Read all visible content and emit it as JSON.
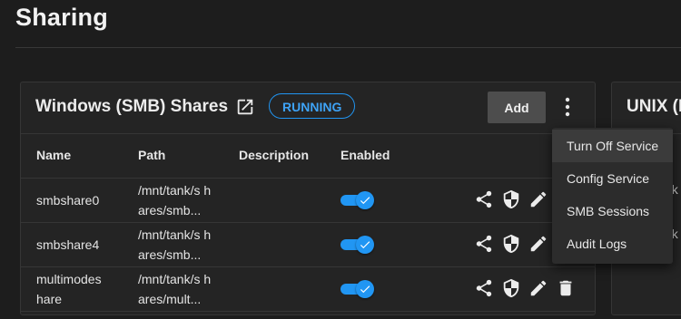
{
  "page": {
    "title": "Sharing"
  },
  "smb_card": {
    "title": "Windows (SMB) Shares",
    "status": "RUNNING",
    "add_label": "Add",
    "columns": [
      "Name",
      "Path",
      "Description",
      "Enabled"
    ],
    "rows": [
      {
        "name": "smbshare0",
        "path": "/mnt/tank/s hares/smb...",
        "description": "",
        "enabled": true
      },
      {
        "name": "smbshare4",
        "path": "/mnt/tank/s hares/smb...",
        "description": "",
        "enabled": true
      },
      {
        "name": "multimodes hare",
        "path": "/mnt/tank/s hares/mult...",
        "description": "",
        "enabled": true
      }
    ]
  },
  "unix_card": {
    "title": "UNIX (N",
    "peek_rows": [
      "nk",
      "nk"
    ]
  },
  "menu": {
    "items": [
      "Turn Off Service",
      "Config Service",
      "SMB Sessions",
      "Audit Logs"
    ]
  },
  "colors": {
    "accent": "#2196f3",
    "background": "#1d1d1d",
    "card": "#242424",
    "menu": "#2c2c2c"
  },
  "icons": [
    "open-in-new-icon",
    "more-vert-icon",
    "share-icon",
    "security-icon",
    "edit-icon",
    "delete-icon",
    "check-icon"
  ]
}
